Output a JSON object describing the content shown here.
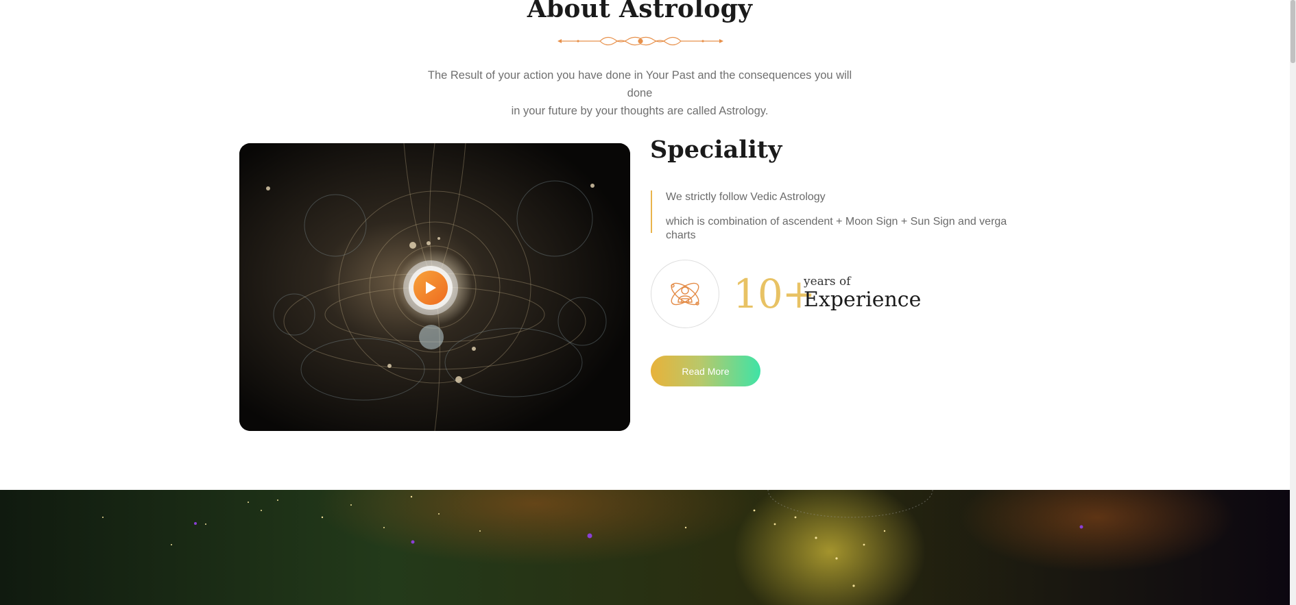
{
  "about": {
    "title": "About Astrology",
    "intro_line1": "The Result of your action you have done in Your Past and the consequences you will done",
    "intro_line2": "in your future by your thoughts are called Astrology."
  },
  "video": {
    "play_icon": "play-icon"
  },
  "speciality": {
    "title": "Speciality",
    "line1": "We strictly follow Vedic Astrology",
    "line2": "which is combination of ascendent + Moon Sign + Sun Sign and verga charts"
  },
  "experience": {
    "icon": "astrologer-icon",
    "number": "10+",
    "small_label": "years of",
    "big_label": "Experience"
  },
  "cta": {
    "read_more": "Read More"
  },
  "colors": {
    "accent_gold": "#e8c264",
    "orange": "#ee6b1f",
    "gradient_start": "#e8b23a",
    "gradient_end": "#3fe3a6"
  }
}
